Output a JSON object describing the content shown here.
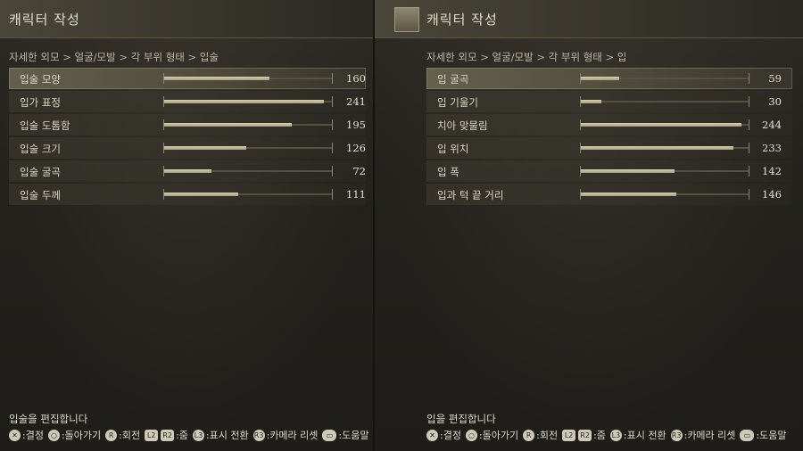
{
  "colors": {
    "accent": "#d8cfae",
    "background": "#1c1b17",
    "text": "#d6d0bd"
  },
  "left": {
    "title": "캐릭터 작성",
    "breadcrumb": "자세한 외모 > 얼굴/모발 > 각 부위 형태 > 입술",
    "rows": [
      {
        "label": "입술 모양",
        "value": "160",
        "level": 0.63,
        "selected": true
      },
      {
        "label": "입가 표정",
        "value": "241",
        "level": 0.95
      },
      {
        "label": "입술 도톰함",
        "value": "195",
        "level": 0.76
      },
      {
        "label": "입술 크기",
        "value": "126",
        "level": 0.49
      },
      {
        "label": "입술 굴곡",
        "value": "72",
        "level": 0.28
      },
      {
        "label": "입술 두께",
        "value": "111",
        "level": 0.44
      }
    ],
    "footer_message": "입술을 편집합니다",
    "controls": [
      {
        "icon": "cross-button-icon",
        "glyph": "✕",
        "text": ":결정"
      },
      {
        "icon": "circle-button-icon",
        "glyph": "○",
        "text": ":돌아가기"
      },
      {
        "icon": "r-stick-icon",
        "glyph": "R",
        "text": ":회전"
      },
      {
        "icon": "l2-button-icon",
        "glyph": "L2",
        "text": ""
      },
      {
        "icon": "r2-button-icon",
        "glyph": "R2",
        "text": ":줌"
      },
      {
        "icon": "l3-button-icon",
        "glyph": "L3",
        "text": ":표시 전환"
      },
      {
        "icon": "r3-button-icon",
        "glyph": "R3",
        "text": ":카메라 리셋"
      },
      {
        "icon": "touchpad-icon",
        "glyph": "▭",
        "text": ":도움말"
      }
    ]
  },
  "right": {
    "title": "캐릭터 작성",
    "portrait_icon": "character-portrait-icon",
    "breadcrumb": "자세한 외모 > 얼굴/모발 > 각 부위 형태 > 입",
    "rows": [
      {
        "label": "입 굴곡",
        "value": "59",
        "level": 0.23,
        "selected": true
      },
      {
        "label": "입 기울기",
        "value": "30",
        "level": 0.12
      },
      {
        "label": "치아 맞물림",
        "value": "244",
        "level": 0.96
      },
      {
        "label": "입 위치",
        "value": "233",
        "level": 0.91
      },
      {
        "label": "입 폭",
        "value": "142",
        "level": 0.56
      },
      {
        "label": "입과 턱 끝 거리",
        "value": "146",
        "level": 0.57
      }
    ],
    "footer_message": "입을 편집합니다",
    "controls": [
      {
        "icon": "cross-button-icon",
        "glyph": "✕",
        "text": ":결정"
      },
      {
        "icon": "circle-button-icon",
        "glyph": "○",
        "text": ":돌아가기"
      },
      {
        "icon": "r-stick-icon",
        "glyph": "R",
        "text": ":회전"
      },
      {
        "icon": "l2-button-icon",
        "glyph": "L2",
        "text": ""
      },
      {
        "icon": "r2-button-icon",
        "glyph": "R2",
        "text": ":줌"
      },
      {
        "icon": "l3-button-icon",
        "glyph": "L3",
        "text": ":표시 전환"
      },
      {
        "icon": "r3-button-icon",
        "glyph": "R3",
        "text": ":카메라 리셋"
      },
      {
        "icon": "touchpad-icon",
        "glyph": "▭",
        "text": ":도움말"
      }
    ]
  }
}
